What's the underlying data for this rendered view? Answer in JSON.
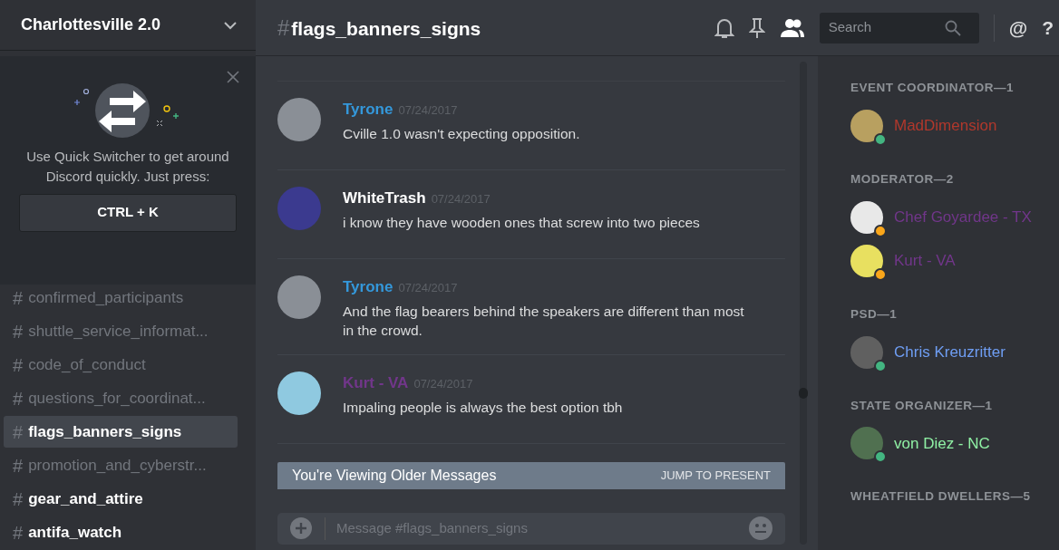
{
  "server": {
    "name": "Charlottesville 2.0"
  },
  "quick_switcher": {
    "text": "Use Quick Switcher to get around Discord quickly. Just press:",
    "shortcut": "CTRL + K"
  },
  "channels": [
    {
      "hash": "#",
      "name": "confirmed_participants",
      "selected": false,
      "unread": false
    },
    {
      "hash": "#",
      "name": "shuttle_service_informat...",
      "selected": false,
      "unread": false
    },
    {
      "hash": "#",
      "name": "code_of_conduct",
      "selected": false,
      "unread": false
    },
    {
      "hash": "#",
      "name": "questions_for_coordinat...",
      "selected": false,
      "unread": false
    },
    {
      "hash": "#",
      "name": "flags_banners_signs",
      "selected": true,
      "unread": false
    },
    {
      "hash": "#",
      "name": "promotion_and_cyberstr...",
      "selected": false,
      "unread": false
    },
    {
      "hash": "#",
      "name": "gear_and_attire",
      "selected": false,
      "unread": true
    },
    {
      "hash": "#",
      "name": "antifa_watch",
      "selected": false,
      "unread": true
    }
  ],
  "header": {
    "hash": "#",
    "channel": "flags_banners_signs",
    "search_placeholder": "Search",
    "mention_glyph": "@",
    "help_glyph": "?"
  },
  "messages": [
    {
      "author": "Tyrone",
      "color": "#3498db",
      "time": "07/24/2017",
      "text": "Cville 1.0 wasn't expecting opposition."
    },
    {
      "author": "WhiteTrash",
      "color": "#ffffff",
      "time": "07/24/2017",
      "text": "i know they have wooden ones that screw into two pieces"
    },
    {
      "author": "Tyrone",
      "color": "#3498db",
      "time": "07/24/2017",
      "text": "And the flag bearers behind the speakers are different than most in the crowd."
    },
    {
      "author": "Kurt - VA",
      "color": "#71368a",
      "time": "07/24/2017",
      "text": "Impaling people is always the best option tbh"
    }
  ],
  "older_banner": {
    "text": "You're Viewing Older Messages",
    "action": "JUMP TO PRESENT"
  },
  "composer": {
    "placeholder": "Message #flags_banners_signs"
  },
  "member_groups": [
    {
      "title": "EVENT COORDINATOR—1",
      "members": [
        {
          "name": "MadDimension",
          "color": "#b1382c",
          "idle": false
        }
      ]
    },
    {
      "title": "MODERATOR—2",
      "members": [
        {
          "name": "Chef Goyardee - TX",
          "color": "#71368a",
          "idle": true
        },
        {
          "name": "Kurt - VA",
          "color": "#71368a",
          "idle": true
        }
      ]
    },
    {
      "title": "PSD—1",
      "members": [
        {
          "name": "Chris Kreuzritter",
          "color": "#6f9ef4",
          "idle": false
        }
      ]
    },
    {
      "title": "STATE ORGANIZER—1",
      "members": [
        {
          "name": "von Diez - NC",
          "color": "#8ff0a4",
          "idle": false
        }
      ]
    },
    {
      "title": "WHEATFIELD DWELLERS—5"
    }
  ]
}
